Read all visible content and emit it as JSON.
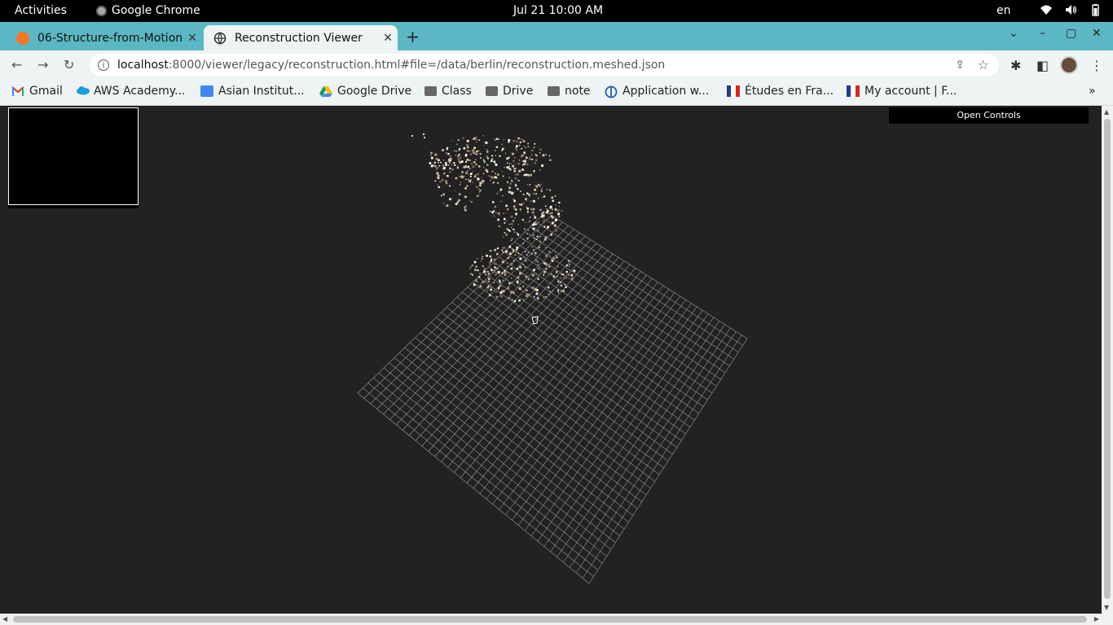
{
  "system_bar": {
    "activities": "Activities",
    "app_name": "Google Chrome",
    "clock": "Jul 21  10:00 AM",
    "lang": "en"
  },
  "tabs": [
    {
      "title": "06-Structure-from-Motion",
      "active": false
    },
    {
      "title": "Reconstruction Viewer",
      "active": true
    }
  ],
  "omnibox": {
    "host": "localhost",
    "path": ":8000/viewer/legacy/reconstruction.html#file=/data/berlin/reconstruction.meshed.json"
  },
  "bookmarks": [
    {
      "label": "Gmail",
      "icon": "gmail-icon"
    },
    {
      "label": "AWS Academy...",
      "icon": "cloud-icon"
    },
    {
      "label": "Asian Institut...",
      "icon": "calendar-icon"
    },
    {
      "label": "Google Drive",
      "icon": "google-drive-icon"
    },
    {
      "label": "Class",
      "icon": "folder-icon"
    },
    {
      "label": "Drive",
      "icon": "folder-icon"
    },
    {
      "label": "note",
      "icon": "folder-icon"
    },
    {
      "label": "Application w...",
      "icon": "globe-icon"
    },
    {
      "label": "Études en Fra...",
      "icon": "flag-icon"
    },
    {
      "label": "My account | F...",
      "icon": "flag-icon"
    }
  ],
  "viewer": {
    "open_controls": "Open Controls"
  },
  "colors": {
    "tabstrip": "#5cb7c4",
    "toolbar": "#eef3f4",
    "viewport_bg": "#222222",
    "grid": "#bbbbbb"
  }
}
